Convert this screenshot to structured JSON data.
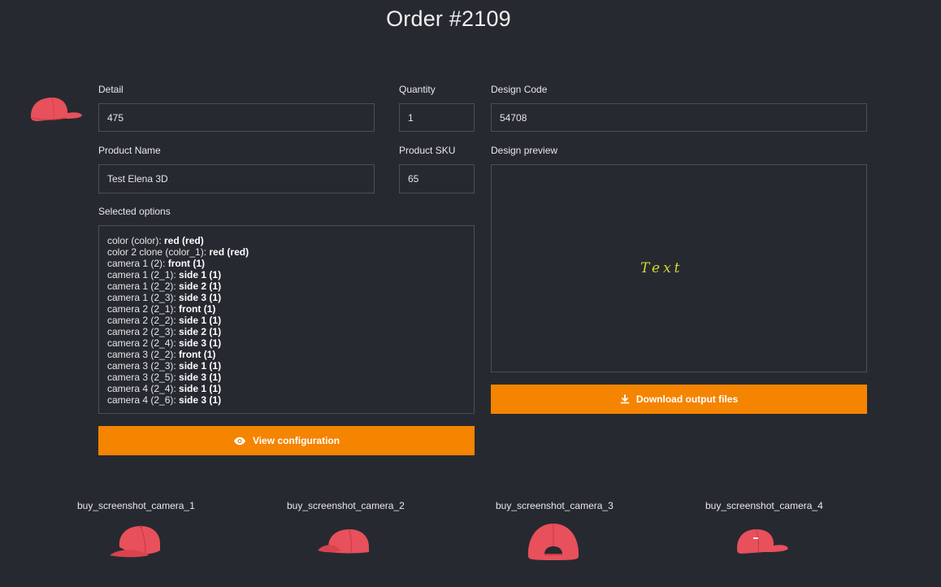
{
  "page": {
    "title": "Order #2109"
  },
  "product_thumbnail": {
    "icon": "cap-icon",
    "color": "#e8505b"
  },
  "fields": {
    "detail": {
      "label": "Detail",
      "value": "475"
    },
    "quantity": {
      "label": "Quantity",
      "value": "1"
    },
    "design_code": {
      "label": "Design Code",
      "value": "54708"
    },
    "product_name": {
      "label": "Product Name",
      "value": "Test Elena 3D"
    },
    "product_sku": {
      "label": "Product SKU",
      "value": "65"
    }
  },
  "selected_options": {
    "label": "Selected options",
    "items": [
      {
        "key": "color (color): ",
        "value": "red (red)"
      },
      {
        "key": "color 2 clone (color_1): ",
        "value": "red (red)"
      },
      {
        "key": "camera 1 (2): ",
        "value": "front (1)"
      },
      {
        "key": "camera 1 (2_1): ",
        "value": "side 1 (1)"
      },
      {
        "key": "camera 1 (2_2): ",
        "value": "side 2 (1)"
      },
      {
        "key": "camera 1 (2_3): ",
        "value": "side 3 (1)"
      },
      {
        "key": "camera 2 (2_1): ",
        "value": "front (1)"
      },
      {
        "key": "camera 2 (2_2): ",
        "value": "side 1 (1)"
      },
      {
        "key": "camera 2 (2_3): ",
        "value": "side 2 (1)"
      },
      {
        "key": "camera 2 (2_4): ",
        "value": "side 3 (1)"
      },
      {
        "key": "camera 3 (2_2): ",
        "value": "front (1)"
      },
      {
        "key": "camera 3 (2_3): ",
        "value": "side 1 (1)"
      },
      {
        "key": "camera 3 (2_5): ",
        "value": "side 3 (1)"
      },
      {
        "key": "camera 4 (2_4): ",
        "value": "side 1 (1)"
      },
      {
        "key": "camera 4 (2_6): ",
        "value": "side 3 (1)"
      }
    ]
  },
  "design_preview": {
    "label": "Design preview",
    "text": "Text",
    "text_color": "#d9d62a"
  },
  "buttons": {
    "view_configuration": {
      "label": "View configuration",
      "icon": "eye-icon"
    },
    "download_output": {
      "label": "Download output files",
      "icon": "download-icon"
    }
  },
  "screenshots": [
    {
      "label": "buy_screenshot_camera_1",
      "view": "front-angle"
    },
    {
      "label": "buy_screenshot_camera_2",
      "view": "side"
    },
    {
      "label": "buy_screenshot_camera_3",
      "view": "back"
    },
    {
      "label": "buy_screenshot_camera_4",
      "view": "side-right"
    }
  ],
  "colors": {
    "accent": "#f58400",
    "background": "#262a30",
    "border": "#4a4f57",
    "cap": "#e8505b"
  }
}
